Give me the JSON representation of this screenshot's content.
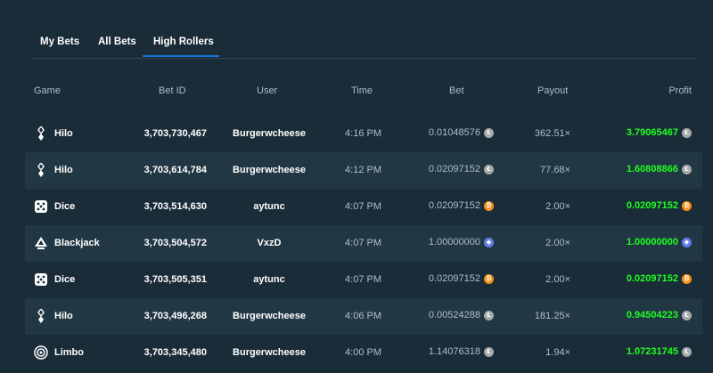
{
  "tabs": [
    {
      "label": "My Bets"
    },
    {
      "label": "All Bets"
    },
    {
      "label": "High Rollers",
      "active": true
    }
  ],
  "columns": {
    "game": "Game",
    "bet_id": "Bet ID",
    "user": "User",
    "time": "Time",
    "bet": "Bet",
    "payout": "Payout",
    "profit": "Profit"
  },
  "colors": {
    "ltc": "#a6a9aa",
    "btc": "#f7931a",
    "eth": "#627eea",
    "profit": "#1fff20",
    "accent": "#1475e1"
  },
  "rows": [
    {
      "game": "Hilo",
      "icon": "hilo-icon",
      "bet_id": "3,703,730,467",
      "user": "Burgerwcheese",
      "time": "4:16 PM",
      "bet": "0.01048576",
      "coin": "ltc",
      "payout": "362.51×",
      "profit": "3.79065467"
    },
    {
      "game": "Hilo",
      "icon": "hilo-icon",
      "bet_id": "3,703,614,784",
      "user": "Burgerwcheese",
      "time": "4:12 PM",
      "bet": "0.02097152",
      "coin": "ltc",
      "payout": "77.68×",
      "profit": "1.60808866"
    },
    {
      "game": "Dice",
      "icon": "dice-icon",
      "bet_id": "3,703,514,630",
      "user": "aytunc",
      "time": "4:07 PM",
      "bet": "0.02097152",
      "coin": "btc",
      "payout": "2.00×",
      "profit": "0.02097152"
    },
    {
      "game": "Blackjack",
      "icon": "blackjack-icon",
      "bet_id": "3,703,504,572",
      "user": "VxzD",
      "time": "4:07 PM",
      "bet": "1.00000000",
      "coin": "eth",
      "payout": "2.00×",
      "profit": "1.00000000"
    },
    {
      "game": "Dice",
      "icon": "dice-icon",
      "bet_id": "3,703,505,351",
      "user": "aytunc",
      "time": "4:07 PM",
      "bet": "0.02097152",
      "coin": "btc",
      "payout": "2.00×",
      "profit": "0.02097152"
    },
    {
      "game": "Hilo",
      "icon": "hilo-icon",
      "bet_id": "3,703,496,268",
      "user": "Burgerwcheese",
      "time": "4:06 PM",
      "bet": "0.00524288",
      "coin": "ltc",
      "payout": "181.25×",
      "profit": "0.94504223"
    },
    {
      "game": "Limbo",
      "icon": "limbo-icon",
      "bet_id": "3,703,345,480",
      "user": "Burgerwcheese",
      "time": "4:00 PM",
      "bet": "1.14076318",
      "coin": "ltc",
      "payout": "1.94×",
      "profit": "1.07231745"
    }
  ]
}
